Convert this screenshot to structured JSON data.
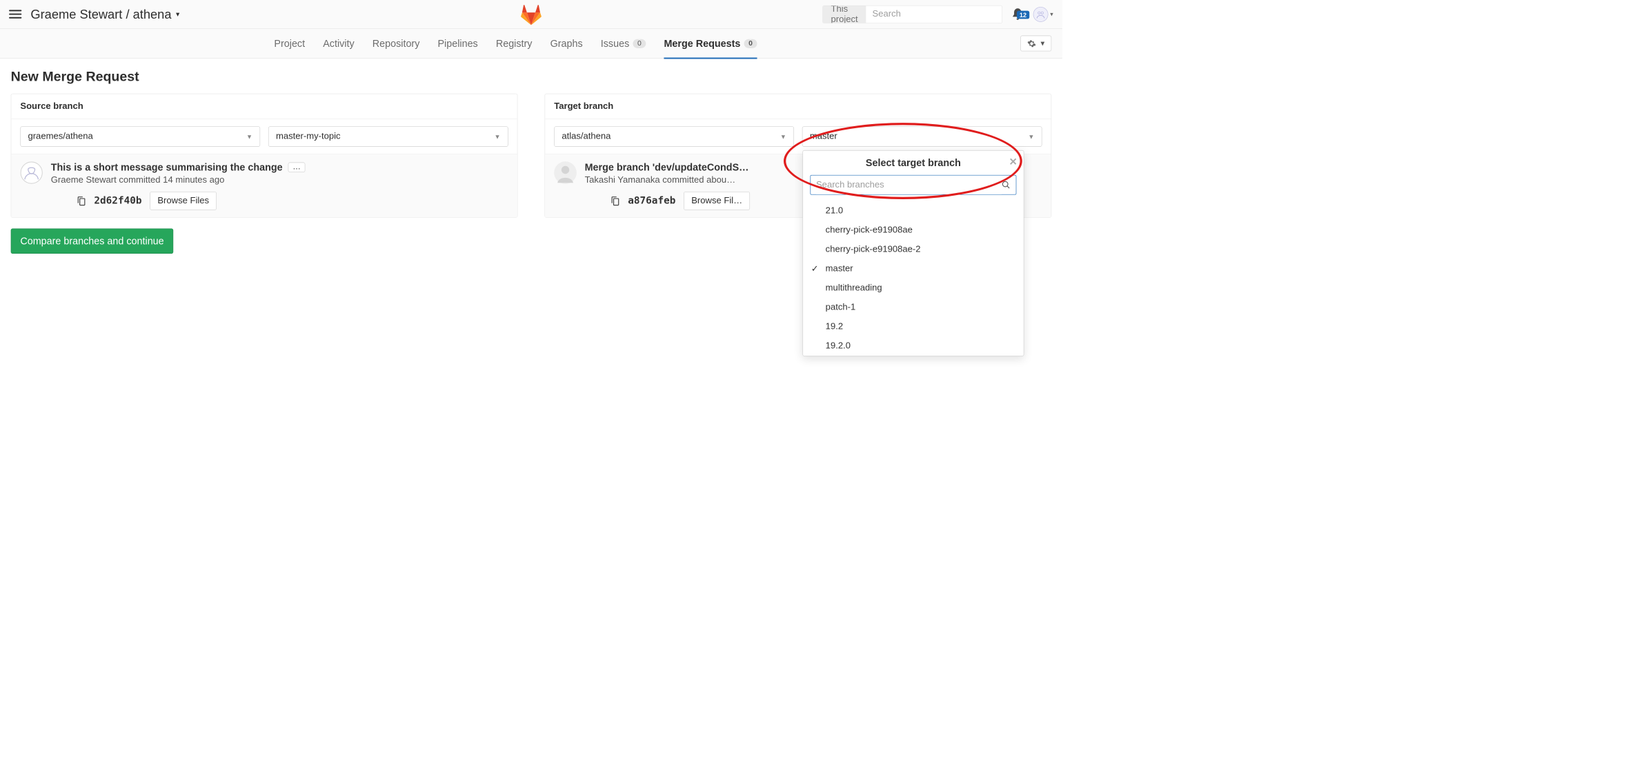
{
  "topbar": {
    "project_title": "Graeme Stewart / athena",
    "search_scope": "This project",
    "search_placeholder": "Search",
    "notifications_count": "12"
  },
  "nav": {
    "tabs": [
      {
        "label": "Project"
      },
      {
        "label": "Activity"
      },
      {
        "label": "Repository"
      },
      {
        "label": "Pipelines"
      },
      {
        "label": "Registry"
      },
      {
        "label": "Graphs"
      },
      {
        "label": "Issues",
        "badge": "0"
      },
      {
        "label": "Merge Requests",
        "badge": "0",
        "active": true
      }
    ]
  },
  "page": {
    "title": "New Merge Request"
  },
  "source": {
    "header": "Source branch",
    "project": "graemes/athena",
    "branch": "master-my-topic",
    "commit": {
      "title": "This is a short message summarising the change",
      "subline": "Graeme Stewart committed 14 minutes ago",
      "hash": "2d62f40b",
      "browse": "Browse Files"
    }
  },
  "target": {
    "header": "Target branch",
    "project": "atlas/athena",
    "branch": "master",
    "commit": {
      "title": "Merge branch 'dev/updateCondS…",
      "subline": "Takashi Yamanaka committed abou…",
      "hash": "a876afeb",
      "browse": "Browse Fil…"
    }
  },
  "branch_popover": {
    "title": "Select target branch",
    "search_placeholder": "Search branches",
    "items": [
      {
        "label": "21.0"
      },
      {
        "label": "cherry-pick-e91908ae"
      },
      {
        "label": "cherry-pick-e91908ae-2"
      },
      {
        "label": "master",
        "checked": true
      },
      {
        "label": "multithreading"
      },
      {
        "label": "patch-1"
      },
      {
        "label": "19.2"
      },
      {
        "label": "19.2.0"
      }
    ]
  },
  "compare_button": "Compare branches and continue"
}
